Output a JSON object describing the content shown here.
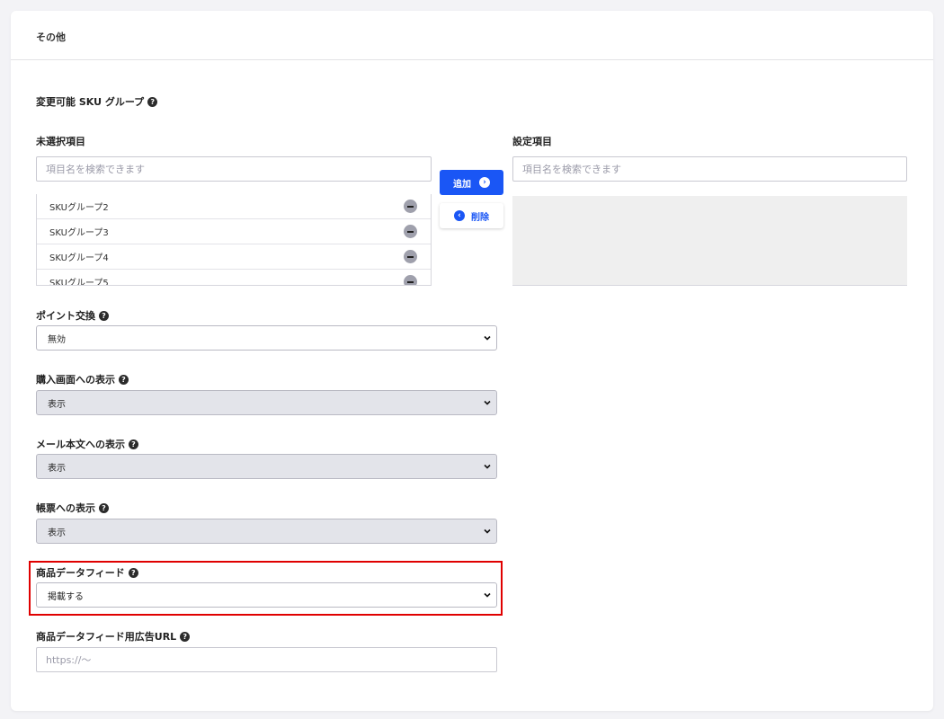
{
  "section": {
    "title": "その他"
  },
  "sku_group": {
    "label": "変更可能 SKU グループ",
    "unselected": {
      "label": "未選択項目",
      "search_placeholder": "項目名を検索できます",
      "items": [
        "SKUグループ2",
        "SKUグループ3",
        "SKUグループ4",
        "SKUグループ5"
      ]
    },
    "selected": {
      "label": "設定項目",
      "search_placeholder": "項目名を検索できます"
    },
    "add_label": "追加",
    "remove_label": "削除"
  },
  "fields": {
    "point_exchange": {
      "label": "ポイント交換",
      "value": "無効"
    },
    "purchase_display": {
      "label": "購入画面への表示",
      "value": "表示"
    },
    "mail_display": {
      "label": "メール本文への表示",
      "value": "表示"
    },
    "form_display": {
      "label": "帳票への表示",
      "value": "表示"
    },
    "product_feed": {
      "label": "商品データフィード",
      "value": "掲載する"
    },
    "feed_url": {
      "label": "商品データフィード用広告URL",
      "placeholder": "https://〜"
    }
  },
  "colors": {
    "accent": "#1a56f5",
    "highlight": "#e00000",
    "disabled_select_bg": "#e3e4ea"
  },
  "icons": {
    "help": "question-circle-icon",
    "remove_item": "minus-circle-icon",
    "add": "chevron-right-circle-icon",
    "remove": "chevron-left-circle-icon",
    "select_arrow": "chevron-down-icon"
  }
}
